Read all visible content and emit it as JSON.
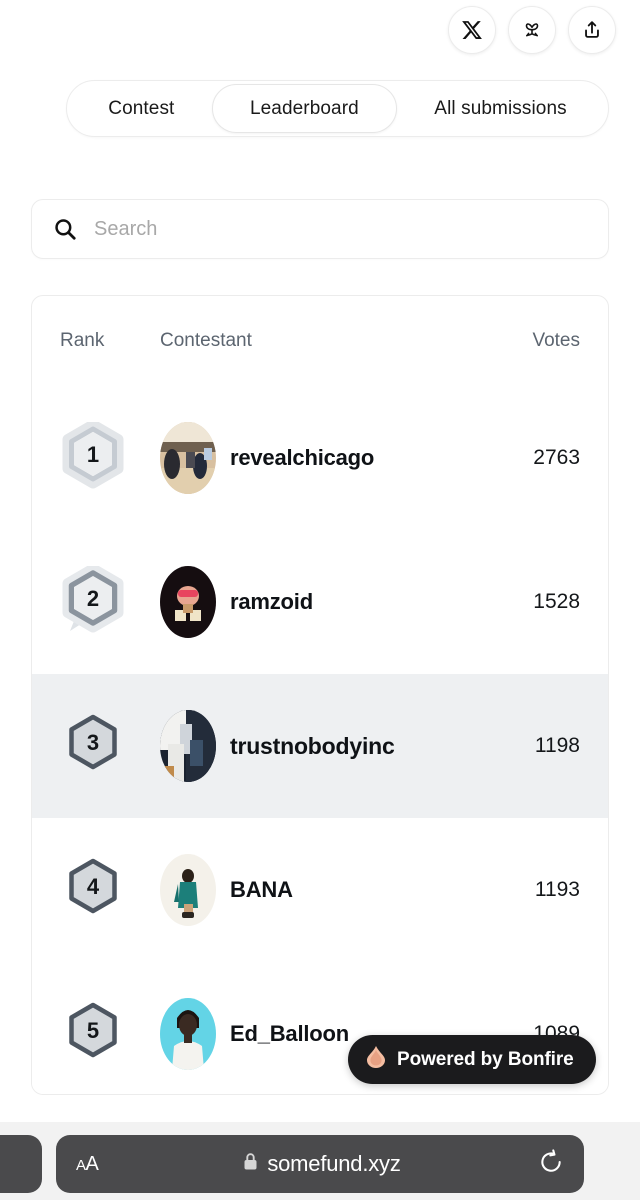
{
  "header": {
    "social_buttons": [
      {
        "name": "x-twitter-icon",
        "label": "X"
      },
      {
        "name": "bluesky-icon",
        "label": "Bluesky"
      },
      {
        "name": "share-icon",
        "label": "Share"
      }
    ]
  },
  "tabs": [
    {
      "label": "Contest",
      "active": false
    },
    {
      "label": "Leaderboard",
      "active": true
    },
    {
      "label": "All submissions",
      "active": false
    }
  ],
  "search": {
    "placeholder": "Search",
    "value": ""
  },
  "leaderboard": {
    "columns": {
      "rank": "Rank",
      "contestant": "Contestant",
      "votes": "Votes"
    },
    "rows": [
      {
        "rank": "1",
        "name": "revealchicago",
        "votes": "2763",
        "badge_style": "silver",
        "highlight": false,
        "avatar_bg": "#c9a87c"
      },
      {
        "rank": "2",
        "name": "ramzoid",
        "votes": "1528",
        "badge_style": "steel",
        "highlight": false,
        "avatar_bg": "#1a1012"
      },
      {
        "rank": "3",
        "name": "trustnobodyinc",
        "votes": "1198",
        "badge_style": "dark",
        "highlight": true,
        "avatar_bg": "#2b3340"
      },
      {
        "rank": "4",
        "name": "BANA",
        "votes": "1193",
        "badge_style": "dark",
        "highlight": false,
        "avatar_bg": "#f3efe7"
      },
      {
        "rank": "5",
        "name": "Ed_Balloon",
        "votes": "1089",
        "badge_style": "dark",
        "highlight": false,
        "avatar_bg": "#6fd8e8"
      }
    ]
  },
  "bonfire_badge": {
    "label": "Powered by Bonfire",
    "bg": "#1b1b1d",
    "flame_color": "#f3b89c"
  },
  "browser": {
    "text_size_label_small": "A",
    "text_size_label_large": "A",
    "url": "somefund.xyz",
    "lock_icon": "lock-icon",
    "reload_icon": "reload-icon"
  }
}
